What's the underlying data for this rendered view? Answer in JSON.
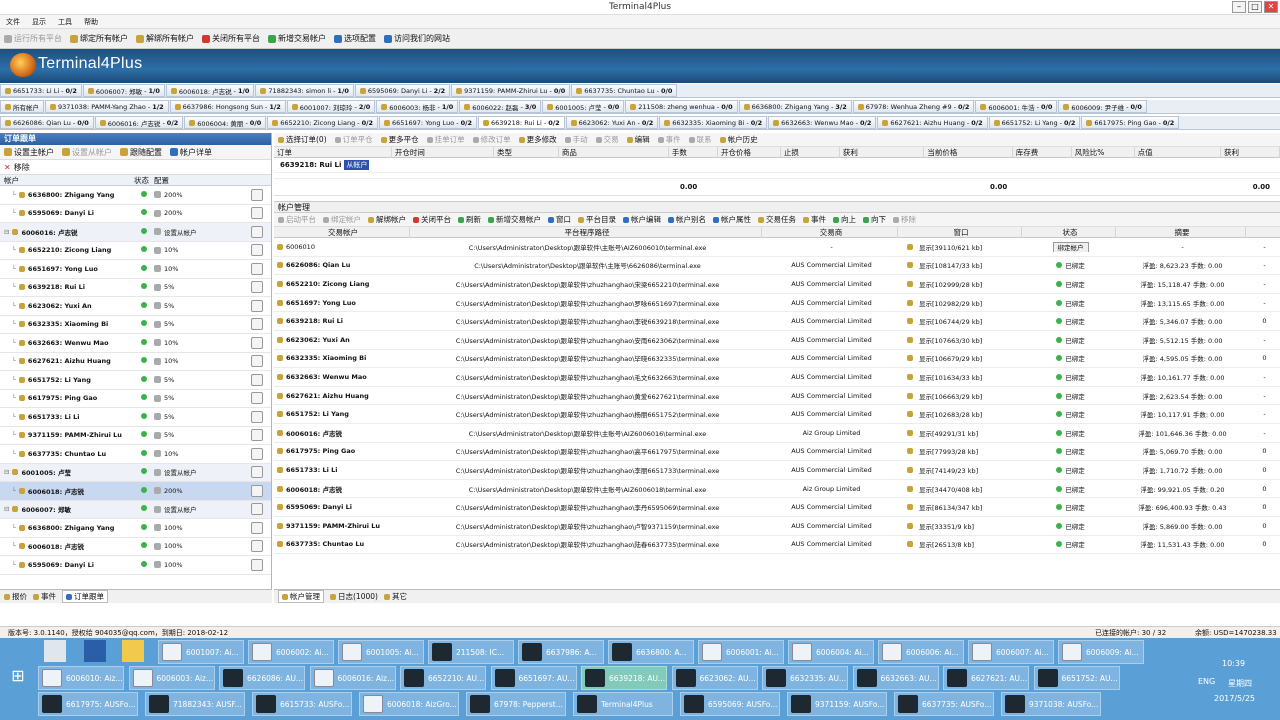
{
  "window": {
    "title": "Terminal4Plus"
  },
  "menu": [
    "文件",
    "显示",
    "工具",
    "帮助"
  ],
  "toolbar": [
    {
      "label": "运行所有平台",
      "enabled": false,
      "icon": "play-icon"
    },
    {
      "label": "绑定所有帐户",
      "enabled": true,
      "icon": "bind-icon"
    },
    {
      "label": "解绑所有帐户",
      "enabled": true,
      "icon": "unbind-icon"
    },
    {
      "label": "关闭所有平台",
      "enabled": true,
      "icon": "power-icon"
    },
    {
      "label": "新增交易帐户",
      "enabled": true,
      "icon": "add-account-icon"
    },
    {
      "label": "选项配置",
      "enabled": true,
      "icon": "gear-icon"
    },
    {
      "label": "访问我们的网站",
      "enabled": true,
      "icon": "globe-icon"
    }
  ],
  "brand": "Terminal4Plus",
  "tabs_row1": [
    [
      "6651733: Li Li",
      "0/2"
    ],
    [
      "6006007: 郑敏",
      "1/0"
    ],
    [
      "6006018: 卢志锐",
      "1/0"
    ],
    [
      "71882343: simon li",
      "1/0"
    ],
    [
      "6595069: Danyi Li",
      "2/2"
    ],
    [
      "9371159: PAMM-Zhirui Lu",
      "0/0"
    ],
    [
      "6637735: Chuntao Lu",
      "0/0"
    ]
  ],
  "tabs_row2": [
    [
      "所有帐户",
      ""
    ],
    [
      "9371038: PAMM-Yang Zhao",
      "1/2"
    ],
    [
      "6637986: Hongsong Sun",
      "1/2"
    ],
    [
      "6001007: 刘琼玲",
      "2/0"
    ],
    [
      "6006003: 杨非",
      "1/0"
    ],
    [
      "6006022: 赵磊",
      "3/0"
    ],
    [
      "6001005: 卢莹",
      "0/0"
    ],
    [
      "211508: zheng wenhua",
      "0/0"
    ],
    [
      "6636800: Zhigang Yang",
      "3/2"
    ],
    [
      "67978: Wenhua Zheng #9",
      "0/2"
    ],
    [
      "6006001: 牛浩",
      "0/0"
    ],
    [
      "6006009: 尹子维",
      "0/0"
    ]
  ],
  "tabs_row3": [
    [
      "6626086: Qian Lu",
      "0/0"
    ],
    [
      "6006016: 卢志锐",
      "0/2"
    ],
    [
      "6006004: 黄丽",
      "0/0"
    ],
    [
      "6652210: Zicong Liang",
      "0/2"
    ],
    [
      "6651697: Yong Luo",
      "0/2"
    ],
    [
      "6639218: Rui Li",
      "0/2"
    ],
    [
      "6623062: Yuxi An",
      "0/2"
    ],
    [
      "6632335: Xiaoming Bi",
      "0/2"
    ],
    [
      "6632663: Wenwu Mao",
      "0/2"
    ],
    [
      "6627621: Aizhu Huang",
      "0/2"
    ],
    [
      "6651752: Li Yang",
      "0/2"
    ],
    [
      "6617975: Ping Gao",
      "0/2"
    ]
  ],
  "left_panel": {
    "title": "订单跟单",
    "toolbar": [
      "设置主帐户",
      "设置从帐户",
      "跟随配置",
      "帐户详单"
    ],
    "remove": "移除",
    "headers": [
      "帐户",
      "状态",
      "配置"
    ],
    "rows": [
      {
        "name": "6636800: Zhigang Yang",
        "cfg": "200%",
        "level": 1
      },
      {
        "name": "6595069: Danyi Li",
        "cfg": "200%",
        "level": 1
      },
      {
        "name": "6006016: 卢志锐",
        "cfg": "设置从帐户",
        "level": 0
      },
      {
        "name": "6652210: Zicong Liang",
        "cfg": "10%",
        "level": 1
      },
      {
        "name": "6651697: Yong Luo",
        "cfg": "10%",
        "level": 1
      },
      {
        "name": "6639218: Rui Li",
        "cfg": "5%",
        "level": 1
      },
      {
        "name": "6623062: Yuxi An",
        "cfg": "5%",
        "level": 1
      },
      {
        "name": "6632335: Xiaoming Bi",
        "cfg": "5%",
        "level": 1
      },
      {
        "name": "6632663: Wenwu Mao",
        "cfg": "10%",
        "level": 1
      },
      {
        "name": "6627621: Aizhu Huang",
        "cfg": "10%",
        "level": 1
      },
      {
        "name": "6651752: Li Yang",
        "cfg": "5%",
        "level": 1
      },
      {
        "name": "6617975: Ping Gao",
        "cfg": "5%",
        "level": 1
      },
      {
        "name": "6651733: Li Li",
        "cfg": "5%",
        "level": 1
      },
      {
        "name": "9371159: PAMM-Zhirui Lu",
        "cfg": "5%",
        "level": 1
      },
      {
        "name": "6637735: Chuntao Lu",
        "cfg": "10%",
        "level": 1
      },
      {
        "name": "6001005: 卢莹",
        "cfg": "设置从帐户",
        "level": 0
      },
      {
        "name": "6006018: 卢志锐",
        "cfg": "200%",
        "level": 1,
        "sel": true
      },
      {
        "name": "6006007: 郑敏",
        "cfg": "设置从帐户",
        "level": 0
      },
      {
        "name": "6636800: Zhigang Yang",
        "cfg": "100%",
        "level": 1
      },
      {
        "name": "6006018: 卢志锐",
        "cfg": "100%",
        "level": 1
      },
      {
        "name": "6595069: Danyi Li",
        "cfg": "100%",
        "level": 1
      }
    ],
    "bottom_tabs": [
      "报价",
      "事件",
      "订单跟单"
    ]
  },
  "orders": {
    "toolbar": [
      "选择订单(0)",
      "订单平仓",
      "更多平仓",
      "挂单订单",
      "修改订单",
      "更多修改",
      "手动",
      "交易",
      "编辑",
      "事件",
      "联系",
      "帐户历史"
    ],
    "headers": [
      "订单",
      "开仓时间",
      "类型",
      "商品",
      "手数",
      "开仓价格",
      "止损",
      "获利",
      "当前价格",
      "库存费",
      "风险比%",
      "点值",
      "获利"
    ],
    "account_label": "6639218: Rui Li",
    "account_tag": "从帐户",
    "totals": [
      "0.00",
      "0.00",
      "0.00"
    ]
  },
  "accounts": {
    "title": "帐户管理",
    "toolbar": [
      "启动平台",
      "绑定帐户",
      "解绑帐户",
      "关闭平台",
      "刷新",
      "新增交易帐户",
      "窗口",
      "平台目录",
      "帐户编辑",
      "帐户别名",
      "帐户属性",
      "交易任务",
      "事件",
      "向上",
      "向下",
      "移除"
    ],
    "headers": [
      "交易帐户",
      "平台程序路径",
      "交易商",
      "窗口",
      "状态",
      "摘要"
    ],
    "rows": [
      {
        "acc": "6006010",
        "path": "C:\\Users\\Administrator\\Desktop\\跟单软件\\主账号\\AIZ6006010\\terminal.exe",
        "broker": "-",
        "win": "显示[39110/621 kb]",
        "status": "绑定帐户",
        "sum": "-",
        "btn": true
      },
      {
        "acc": "6626086: Qian Lu",
        "path": "C:\\Users\\Administrator\\Desktop\\跟单软件\\主账号\\6626086\\terminal.exe",
        "broker": "AUS Commercial Limited",
        "win": "显示[108147/33 kb]",
        "status": "已绑定",
        "sum": "浮盈: 8,623.23  手数: 0.00"
      },
      {
        "acc": "6652210: Zicong Liang",
        "path": "C:\\Users\\Administrator\\Desktop\\跟单软件\\zhuzhanghao\\宋梁6652210\\terminal.exe",
        "broker": "AUS Commercial Limited",
        "win": "显示[102999/28 kb]",
        "status": "已绑定",
        "sum": "浮盈: 15,118.47  手数: 0.00"
      },
      {
        "acc": "6651697: Yong Luo",
        "path": "C:\\Users\\Administrator\\Desktop\\跟单软件\\zhuzhanghao\\罗咏6651697\\terminal.exe",
        "broker": "AUS Commercial Limited",
        "win": "显示[102982/29 kb]",
        "status": "已绑定",
        "sum": "浮盈: 13,115.65  手数: 0.00"
      },
      {
        "acc": "6639218: Rui Li",
        "path": "C:\\Users\\Administrator\\Desktop\\跟单软件\\zhuzhanghao\\李锐6639218\\terminal.exe",
        "broker": "AUS Commercial Limited",
        "win": "显示[106744/29 kb]",
        "status": "已绑定",
        "sum": "浮盈: 5,346.07  手数: 0.00"
      },
      {
        "acc": "6623062: Yuxi An",
        "path": "C:\\Users\\Administrator\\Desktop\\跟单软件\\zhuzhanghao\\安雨6623062\\terminal.exe",
        "broker": "AUS Commercial Limited",
        "win": "显示[107663/30 kb]",
        "status": "已绑定",
        "sum": "浮盈: 5,512.15  手数: 0.00"
      },
      {
        "acc": "6632335: Xiaoming Bi",
        "path": "C:\\Users\\Administrator\\Desktop\\跟单软件\\zhuzhanghao\\毕晓6632335\\terminal.exe",
        "broker": "AUS Commercial Limited",
        "win": "显示[106679/29 kb]",
        "status": "已绑定",
        "sum": "浮盈: 4,595.05  手数: 0.00"
      },
      {
        "acc": "6632663: Wenwu Mao",
        "path": "C:\\Users\\Administrator\\Desktop\\跟单软件\\zhuzhanghao\\毛文6632663\\terminal.exe",
        "broker": "AUS Commercial Limited",
        "win": "显示[101634/33 kb]",
        "status": "已绑定",
        "sum": "浮盈: 10,161.77  手数: 0.00"
      },
      {
        "acc": "6627621: Aizhu Huang",
        "path": "C:\\Users\\Administrator\\Desktop\\跟单软件\\zhuzhanghao\\黄爱6627621\\terminal.exe",
        "broker": "AUS Commercial Limited",
        "win": "显示[106663/29 kb]",
        "status": "已绑定",
        "sum": "浮盈: 2,623.54  手数: 0.00"
      },
      {
        "acc": "6651752: Li Yang",
        "path": "C:\\Users\\Administrator\\Desktop\\跟单软件\\zhuzhanghao\\杨丽6651752\\terminal.exe",
        "broker": "AUS Commercial Limited",
        "win": "显示[102683/28 kb]",
        "status": "已绑定",
        "sum": "浮盈: 10,117.91  手数: 0.00"
      },
      {
        "acc": "6006016: 卢志锐",
        "path": "C:\\Users\\Administrator\\Desktop\\跟单软件\\主账号\\AIZ6006016\\terminal.exe",
        "broker": "Aiz Group Limited",
        "win": "显示[49291/31 kb]",
        "status": "已绑定",
        "sum": "浮盈: 101,646.36  手数: 0.00"
      },
      {
        "acc": "6617975: Ping Gao",
        "path": "C:\\Users\\Administrator\\Desktop\\跟单软件\\zhuzhanghao\\高平6617975\\terminal.exe",
        "broker": "AUS Commercial Limited",
        "win": "显示[77993/28 kb]",
        "status": "已绑定",
        "sum": "浮盈: 5,069.70  手数: 0.00"
      },
      {
        "acc": "6651733: Li Li",
        "path": "C:\\Users\\Administrator\\Desktop\\跟单软件\\zhuzhanghao\\李丽6651733\\terminal.exe",
        "broker": "AUS Commercial Limited",
        "win": "显示[74149/23 kb]",
        "status": "已绑定",
        "sum": "浮盈: 1,710.72  手数: 0.00"
      },
      {
        "acc": "6006018: 卢志锐",
        "path": "C:\\Users\\Administrator\\Desktop\\跟单软件\\主账号\\AIZ6006018\\terminal.exe",
        "broker": "Aiz Group Limited",
        "win": "显示[34470/408 kb]",
        "status": "已绑定",
        "sum": "浮盈: 99,921.05  手数: 0.20"
      },
      {
        "acc": "6595069: Danyi Li",
        "path": "C:\\Users\\Administrator\\Desktop\\跟单软件\\zhuzhanghao\\李丹6595069\\terminal.exe",
        "broker": "AUS Commercial Limited",
        "win": "显示[86134/347 kb]",
        "status": "已绑定",
        "sum": "浮盈: 696,400.93  手数: 0.43"
      },
      {
        "acc": "9371159: PAMM-Zhirui Lu",
        "path": "C:\\Users\\Administrator\\Desktop\\跟单软件\\zhuzhanghao\\卢智9371159\\terminal.exe",
        "broker": "AUS Commercial Limited",
        "win": "显示[33351/9 kb]",
        "status": "已绑定",
        "sum": "浮盈: 5,869.00  手数: 0.00"
      },
      {
        "acc": "6637735: Chuntao Lu",
        "path": "C:\\Users\\Administrator\\Desktop\\跟单软件\\zhuzhanghao\\陆春6637735\\terminal.exe",
        "broker": "AUS Commercial Limited",
        "win": "显示[26513/8 kb]",
        "status": "已绑定",
        "sum": "浮盈: 11,531.43  手数: 0.00"
      }
    ],
    "row_end": [
      "-",
      "-",
      "-",
      "-",
      "0",
      "-",
      "0",
      "-",
      "-",
      "-",
      "-",
      "0",
      "0",
      "0",
      "0",
      "0",
      "0"
    ],
    "bottom_tabs": [
      "帐户管理",
      "日志(1000)",
      "其它"
    ]
  },
  "statusbar": {
    "left": "版本号: 3.0.1140，授权给 904035@qq.com，到期日: 2018-02-12",
    "conn": "已连接的帐户: 30 / 32",
    "bal": "余额: USD=1470238.33"
  },
  "taskbar": {
    "row1": [
      "6001007: Ai...",
      "6006002: Ai...",
      "6001005: Ai...",
      "211508: IC...",
      "6637986: A...",
      "6636800: A...",
      "6006001: Ai...",
      "6006004: Ai...",
      "6006006: Ai...",
      "6006007: Ai...",
      "6006009: Ai..."
    ],
    "row2": [
      "6006010: Aiz...",
      "6006003: Aiz...",
      "6626086: AU...",
      "6006016: Aiz...",
      "6652210: AU...",
      "6651697: AU...",
      "6639218: AU...",
      "6623062: AU...",
      "6632335: AU...",
      "6632663: AU...",
      "6627621: AU...",
      "6651752: AU..."
    ],
    "row3": [
      "6617975: AUSFo...",
      "71882343: AUSF...",
      "6615733: AUSFo...",
      "6006018: AizGro...",
      "67978: Pepperst...",
      "Terminal4Plus",
      "6595069: AUSFo...",
      "9371159: AUSFo...",
      "6637735: AUSFo...",
      "9371038: AUSFo..."
    ],
    "time": "10:39",
    "date": "2017/5/25",
    "weekday": "星期四",
    "lang": "ENG"
  }
}
